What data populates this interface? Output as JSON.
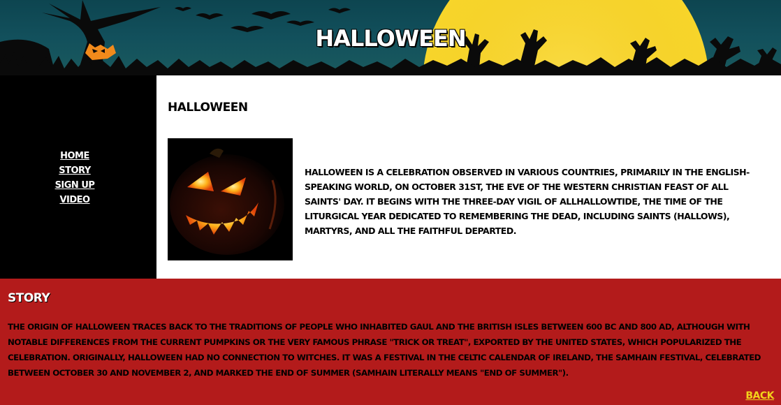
{
  "header": {
    "title": "HALLOWEEN"
  },
  "nav": {
    "items": [
      {
        "label": "HOME"
      },
      {
        "label": "STORY"
      },
      {
        "label": "SIGN UP"
      },
      {
        "label": "VIDEO"
      }
    ]
  },
  "main": {
    "heading": "HALLOWEEN",
    "intro": "HALLOWEEN IS A CELEBRATION OBSERVED IN VARIOUS COUNTRIES, PRIMARILY IN THE ENGLISH-SPEAKING WORLD, ON OCTOBER 31ST, THE EVE OF THE WESTERN CHRISTIAN FEAST OF ALL SAINTS' DAY. IT BEGINS WITH THE THREE-DAY VIGIL OF ALLHALLOWTIDE, THE TIME OF THE LITURGICAL YEAR DEDICATED TO REMEMBERING THE DEAD, INCLUDING SAINTS (HALLOWS), MARTYRS, AND ALL THE FAITHFUL DEPARTED."
  },
  "story": {
    "heading": "STORY",
    "text": "THE ORIGIN OF HALLOWEEN TRACES BACK TO THE TRADITIONS OF PEOPLE WHO INHABITED GAUL AND THE BRITISH ISLES BETWEEN 600 BC AND 800 AD, ALTHOUGH WITH NOTABLE DIFFERENCES FROM THE CURRENT PUMPKINS OR THE VERY FAMOUS PHRASE \"TRICK OR TREAT\", EXPORTED BY THE UNITED STATES, WHICH POPULARIZED THE CELEBRATION. ORIGINALLY, HALLOWEEN HAD NO CONNECTION TO WITCHES. IT WAS A FESTIVAL IN THE CELTIC CALENDAR OF IRELAND, THE SAMHAIN FESTIVAL, CELEBRATED BETWEEN OCTOBER 30 AND NOVEMBER 2, AND MARKED THE END OF SUMMER (SAMHAIN LITERALLY MEANS \"END OF SUMMER\").",
    "back_label": "BACK"
  },
  "colors": {
    "header_sky": "#0d4550",
    "moon": "#f7d52a",
    "sidebar": "#000000",
    "story_bg": "#b31b1b",
    "back_link": "#f2d21b"
  }
}
